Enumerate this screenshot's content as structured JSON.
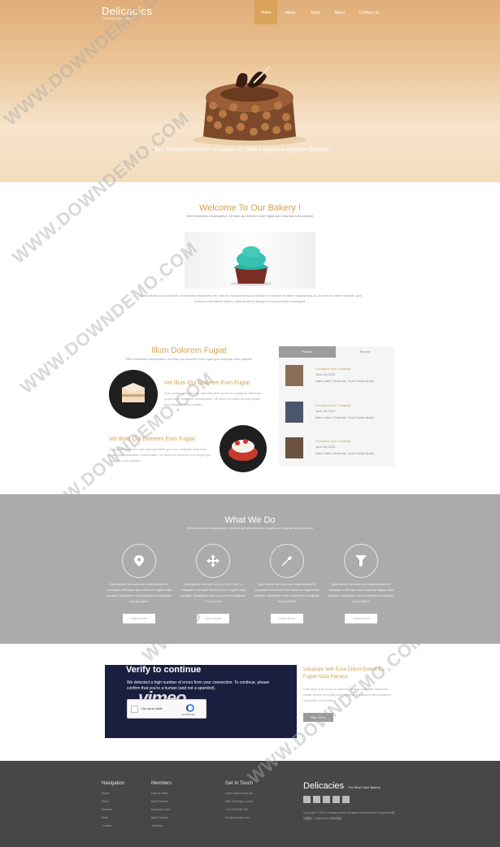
{
  "header": {
    "logo": "Delicacies",
    "tagline": "The Best Cake Bakery",
    "nav": [
      {
        "label": "Home",
        "active": true
      },
      {
        "label": "About",
        "active": false
      },
      {
        "label": "Tools",
        "active": false
      },
      {
        "label": "Menu",
        "active": false
      },
      {
        "label": "Contact Us",
        "active": false
      }
    ]
  },
  "hero": {
    "caption": "Illum Tempora Incidunt Ut Labore Et Dolore Magnam Aliquam Quaerat"
  },
  "welcome": {
    "title": "Welcome To Our Bakery !",
    "subtitle": "Nihil molestiae consequatur, vel illum qui dolorem eum fugiat quo voluptas nulla pariatur",
    "paragraph": "Lorem ipsum dolor sit amet, consectetur adipisicing elit, sed do eiusmod tempor incididunt ut labore et dolore magna aliqua. Ut enim ad minim veniam, quis nostrud exercitation ullamco laboris nisi ut aliquip ex ea commodo consequat."
  },
  "illum": {
    "title": "Illum Dolorem Fugiat",
    "subtitle": "Nihil molestiae consequatur, vel illum qui dolorem eum fugiat quo voluptas nulla pariatur",
    "features": [
      {
        "title": "Vel Illum Qui Dolorem Eum Fugiat",
        "text": "Quis autem vel eum iure reprehenderit qui in ea voluptate velit esse quam nihil molestiae consequatur, vel illum qui dolorem eum fugiat quo voluptas nulla pariatur"
      },
      {
        "title": "Vel Illum Qui Dolorem Eum Fugiat",
        "text": "Quis autem vel eum iure reprehenderit qui in ea voluptate velit esse quam nihil molestiae consequatur, vel illum qui dolorem eum fugiat quo voluptas nulla pariatur"
      }
    ]
  },
  "tabs": {
    "labels": [
      "Popular",
      "Recent"
    ],
    "posts": [
      {
        "title": "Excepteur sint Occaecat",
        "date": "June 26,2015",
        "text": "Nam Libero Tempore, Cum Soluta Nobis"
      },
      {
        "title": "Excepteur sint Occaecat",
        "date": "June 26,2015",
        "text": "Nam Libero Tempore, Cum Soluta Nobis"
      },
      {
        "title": "Excepteur sint Occaecat",
        "date": "June 26,2015",
        "text": "Nam Libero Tempore, Cum Soluta Nobis"
      }
    ]
  },
  "services": {
    "title": "What We Do",
    "subtitle": "Nihil molestiae consequatur, vel illum qui dolorem eum fugiat quo voluptas nulla pariatur",
    "items": [
      {
        "icon": "map-marker-icon",
        "text": "Quis autem vel eum iure reprehenderit in voluptate velit esse illum dolorem fugiat nulla pariatur. Excepteur sint occaecat et voluptate non proident.",
        "button": "Learn More"
      },
      {
        "icon": "move-arrows-icon",
        "text": "Quis autem vel eum iure reprehenderit in voluptate velit esse illum dolorem fugiat nulla pariatur. Excepteur sint occaecat et voluptate non proident.",
        "button": "Learn More"
      },
      {
        "icon": "wrench-icon",
        "text": "Quis autem vel eum iure reprehenderit in voluptate velit esse illum dolorem fugiat nulla pariatur. Excepteur sint occaecat et voluptate non proident.",
        "button": "Learn More"
      },
      {
        "icon": "filter-icon",
        "text": "Quis autem vel eum iure reprehenderit in voluptate velit esse illum dolorem fugiat nulla pariatur. Excepteur sint occaecat et voluptate non proident.",
        "button": "Learn More"
      }
    ]
  },
  "video": {
    "heading": "Verify to continue",
    "message": "We detected a high number of errors from your connection. To continue, please confirm that you're a human (and not a spambot).",
    "logo": "vimeo",
    "captcha_label": "I'm not a robot",
    "captcha_brand": "reCAPTCHA",
    "side_title": "Voluptate Velit Esse Cillum Dolore Eu Fugiat Nulla Pariatur",
    "side_text": "Duis aute irure dolor in reprehenderit in voluptate velit esse cillum dolore eu fugiat nulla pariatur. Excepteur sint occaecat cupidatat non proident.",
    "side_button": "See Video"
  },
  "footer": {
    "columns": [
      {
        "heading": "Navigation",
        "links": [
          "Home",
          "Menu",
          "Services",
          "Short",
          "Contact"
        ]
      },
      {
        "heading": "Members",
        "links": [
          "Duis At Nulla",
          "Nulla Pariatur",
          "Excepteur Sint",
          "Nulla Facilisis",
          "Tincidunt"
        ]
      },
      {
        "heading": "Get In Touch",
        "links": [
          "Lorem ipsum dolor sit",
          "4567 Eiusmod, Lorem",
          "+12 345 6789 000",
          "info@example.com"
        ]
      }
    ],
    "logo": "Delicacies",
    "tagline": "The Best Cake Bakery",
    "social": [
      "facebook-icon",
      "twitter-icon",
      "google-icon",
      "linkedin-icon",
      "rss-icon"
    ],
    "copyright": "Copyright © 2015 Company name All rights reserved More Templates 网站模板 - Collect from 网页模板"
  },
  "watermark": "WWW.DOWNDEMO.COM"
}
